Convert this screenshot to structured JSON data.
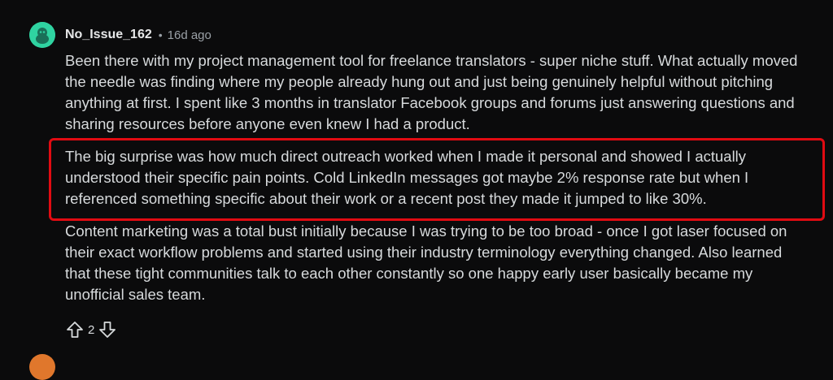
{
  "comment": {
    "username": "No_Issue_162",
    "separator": "•",
    "timestamp": "16d ago",
    "paragraphs": [
      "Been there with my project management tool for freelance translators - super niche stuff. What actually moved the needle was finding where my people already hung out and just being genuinely helpful without pitching anything at first. I spent like 3 months in translator Facebook groups and forums just answering questions and sharing resources before anyone even knew I had a product.",
      "The big surprise was how much direct outreach worked when I made it personal and showed I actually understood their specific pain points. Cold LinkedIn messages got maybe 2% response rate but when I referenced something specific about their work or a recent post they made it jumped to like 30%.",
      "Content marketing was a total bust initially because I was trying to be too broad - once I got laser focused on their exact workflow problems and started using their industry terminology everything changed. Also learned that these tight communities talk to each other constantly so one happy early user basically became my unofficial sales team."
    ],
    "score": "2"
  },
  "icons": {
    "avatar": "snoo-avatar-icon",
    "upvote": "arrow-up-icon",
    "downvote": "arrow-down-icon"
  },
  "colors": {
    "background": "#0b0b0c",
    "text": "#d7dadc",
    "muted": "#9aa0a6",
    "avatar": "#2fd3a1",
    "highlight": "#e10b12"
  }
}
